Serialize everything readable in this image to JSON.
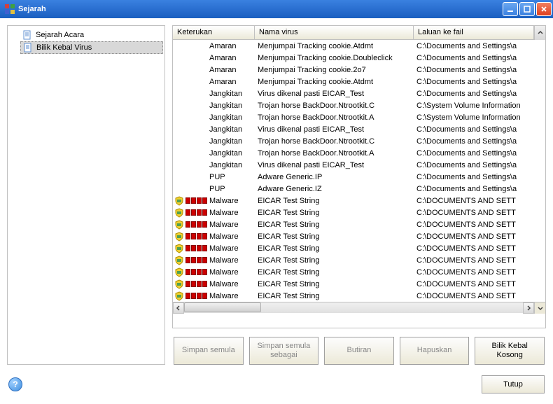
{
  "window": {
    "title": "Sejarah"
  },
  "sidebar": {
    "items": [
      {
        "label": "Sejarah Acara",
        "selected": false
      },
      {
        "label": "Bilik Kebal Virus",
        "selected": true
      }
    ]
  },
  "table": {
    "headers": {
      "col1": "Keterukan",
      "col2": "Nama virus",
      "col3": "Laluan ke fail"
    },
    "rows": [
      {
        "sev": "Amaran",
        "icon": false,
        "name": "Menjumpai Tracking cookie.Atdmt",
        "path": "C:\\Documents and Settings\\a"
      },
      {
        "sev": "Amaran",
        "icon": false,
        "name": "Menjumpai Tracking cookie.Doubleclick",
        "path": "C:\\Documents and Settings\\a"
      },
      {
        "sev": "Amaran",
        "icon": false,
        "name": "Menjumpai Tracking cookie.2o7",
        "path": "C:\\Documents and Settings\\a"
      },
      {
        "sev": "Amaran",
        "icon": false,
        "name": "Menjumpai Tracking cookie.Atdmt",
        "path": "C:\\Documents and Settings\\a"
      },
      {
        "sev": "Jangkitan",
        "icon": false,
        "name": "Virus dikenal pasti EICAR_Test",
        "path": "C:\\Documents and Settings\\a"
      },
      {
        "sev": "Jangkitan",
        "icon": false,
        "name": "Trojan horse BackDoor.Ntrootkit.C",
        "path": "C:\\System Volume Information"
      },
      {
        "sev": "Jangkitan",
        "icon": false,
        "name": "Trojan horse BackDoor.Ntrootkit.A",
        "path": "C:\\System Volume Information"
      },
      {
        "sev": "Jangkitan",
        "icon": false,
        "name": "Virus dikenal pasti EICAR_Test",
        "path": "C:\\Documents and Settings\\a"
      },
      {
        "sev": "Jangkitan",
        "icon": false,
        "name": "Trojan horse BackDoor.Ntrootkit.C",
        "path": "C:\\Documents and Settings\\a"
      },
      {
        "sev": "Jangkitan",
        "icon": false,
        "name": "Trojan horse BackDoor.Ntrootkit.A",
        "path": "C:\\Documents and Settings\\a"
      },
      {
        "sev": "Jangkitan",
        "icon": false,
        "name": "Virus dikenal pasti EICAR_Test",
        "path": "C:\\Documents and Settings\\a"
      },
      {
        "sev": "PUP",
        "icon": false,
        "name": "Adware Generic.IP",
        "path": "C:\\Documents and Settings\\a"
      },
      {
        "sev": "PUP",
        "icon": false,
        "name": "Adware Generic.IZ",
        "path": "C:\\Documents and Settings\\a"
      },
      {
        "sev": "Malware",
        "icon": true,
        "name": "EICAR Test String",
        "path": "C:\\DOCUMENTS AND SETT"
      },
      {
        "sev": "Malware",
        "icon": true,
        "name": "EICAR Test String",
        "path": "C:\\DOCUMENTS AND SETT"
      },
      {
        "sev": "Malware",
        "icon": true,
        "name": "EICAR Test String",
        "path": "C:\\DOCUMENTS AND SETT"
      },
      {
        "sev": "Malware",
        "icon": true,
        "name": "EICAR Test String",
        "path": "C:\\DOCUMENTS AND SETT"
      },
      {
        "sev": "Malware",
        "icon": true,
        "name": "EICAR Test String",
        "path": "C:\\DOCUMENTS AND SETT"
      },
      {
        "sev": "Malware",
        "icon": true,
        "name": "EICAR Test String",
        "path": "C:\\DOCUMENTS AND SETT"
      },
      {
        "sev": "Malware",
        "icon": true,
        "name": "EICAR Test String",
        "path": "C:\\DOCUMENTS AND SETT"
      },
      {
        "sev": "Malware",
        "icon": true,
        "name": "EICAR Test String",
        "path": "C:\\DOCUMENTS AND SETT"
      },
      {
        "sev": "Malware",
        "icon": true,
        "name": "EICAR Test String",
        "path": "C:\\DOCUMENTS AND SETT"
      }
    ]
  },
  "buttons": {
    "restore": "Simpan semula",
    "restore_as": "Simpan semula\nsebagai",
    "details": "Butiran",
    "delete": "Hapuskan",
    "empty_vault": "Bilik Kebal\nKosong"
  },
  "footer": {
    "close": "Tutup"
  }
}
